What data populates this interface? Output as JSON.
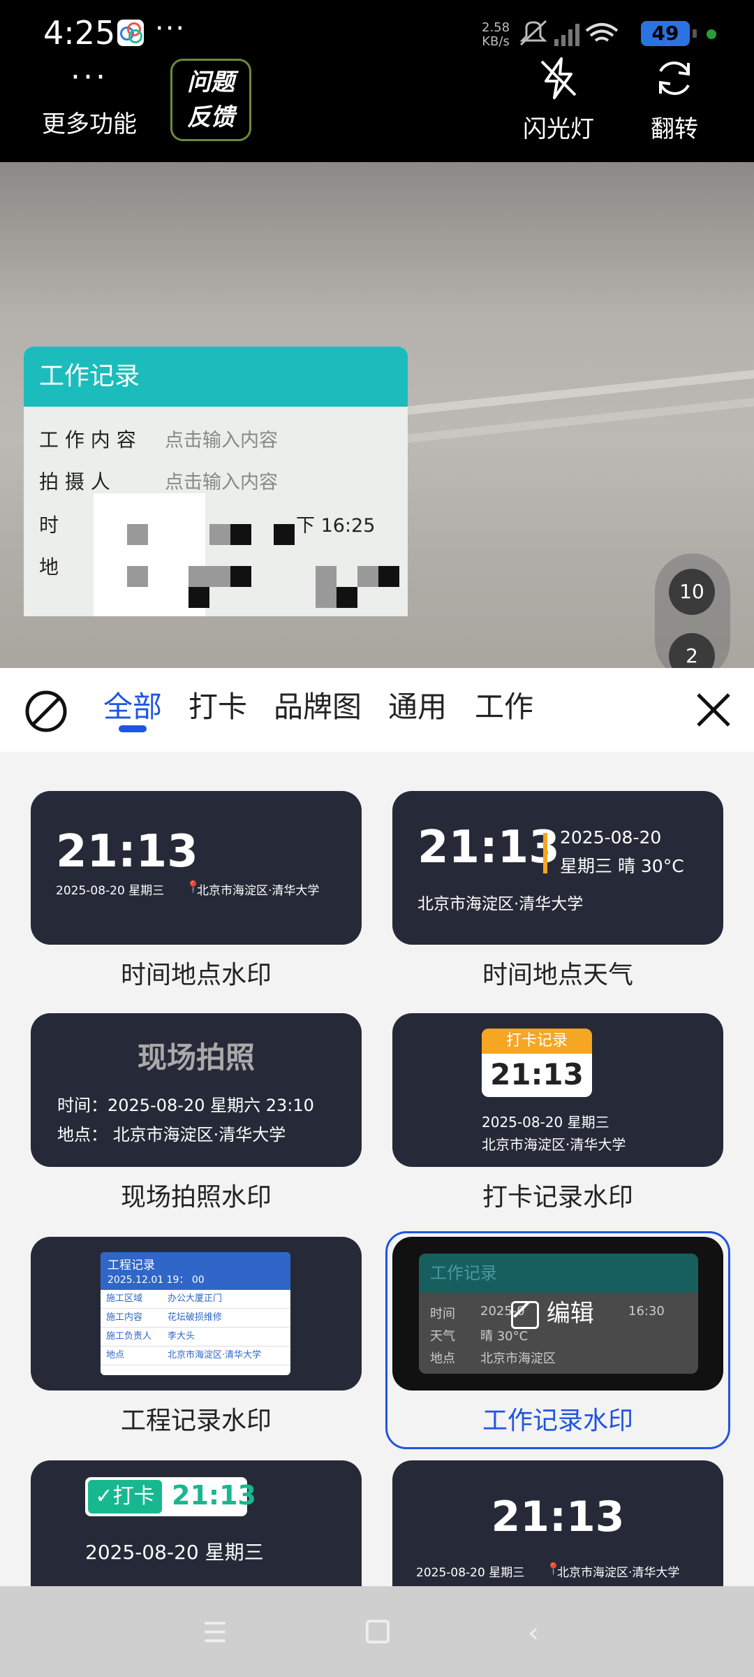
{
  "status": {
    "time": "4:25",
    "dots": "···",
    "speed_top": "2.58",
    "speed_bottom": "KB/s",
    "battery": "49"
  },
  "camera_bar": {
    "more_icon": "···",
    "more_label": "更多功能",
    "feedback_line1": "问题",
    "feedback_line2": "反馈",
    "flash_label": "闪光灯",
    "flip_label": "翻转"
  },
  "watermark": {
    "title": "工作记录",
    "rows": [
      {
        "label": "工 作 内 容",
        "value": "点击输入内容"
      },
      {
        "label": "拍   摄   人",
        "value": "点击输入内容"
      },
      {
        "label": "时",
        "value": "下 16:25"
      },
      {
        "label": "地",
        "value": ""
      }
    ]
  },
  "zoom": {
    "level1": "10",
    "level2": "2"
  },
  "tabs": [
    {
      "label": "全部",
      "active": true
    },
    {
      "label": "打卡"
    },
    {
      "label": "品牌图"
    },
    {
      "label": "通用"
    },
    {
      "label": "工作"
    }
  ],
  "templates": {
    "t1": {
      "time": "21:13",
      "line": "2025-08-20 星期三",
      "place": "北京市海淀区·清华大学",
      "caption": "时间地点水印"
    },
    "t2": {
      "time": "21:13",
      "date": "2025-08-20",
      "weather": "星期三 晴 30°C",
      "place": "北京市海淀区·清华大学",
      "caption": "时间地点天气"
    },
    "t3": {
      "title": "现场拍照",
      "time_line": "时间：2025-08-20  星期六 23:10",
      "place_line": "地点： 北京市海淀区·清华大学",
      "caption": "现场拍照水印"
    },
    "t4": {
      "badge": "打卡记录",
      "time": "21:13",
      "date": "2025-08-20 星期三",
      "place": "北京市海淀区·清华大学",
      "caption": "打卡记录水印"
    },
    "t5": {
      "title": "工程记录",
      "datetime": "2025.12.01 19： 00",
      "rows": [
        {
          "k": "施工区域",
          "v": "办公大厦正门"
        },
        {
          "k": "施工内容",
          "v": "花坛破损维修"
        },
        {
          "k": "施工负责人",
          "v": "李大头"
        },
        {
          "k": "地点",
          "v": "北京市海淀区·清华大学"
        }
      ],
      "caption": "工程记录水印"
    },
    "t6": {
      "title": "工作记录",
      "r1k": "时间",
      "r1v": "2025-0",
      "r1v2": "16:30",
      "r2k": "天气",
      "r2v": "晴 30°C",
      "r3k": "地点",
      "r3v": "北京市海淀区",
      "edit": "编辑",
      "caption": "工作记录水印"
    },
    "t7": {
      "badge": "打卡",
      "time": "21:13",
      "date": "2025-08-20 星期三"
    },
    "t8": {
      "time": "21:13",
      "line": "2025-08-20 星期三",
      "place": "北京市海淀区·清华大学"
    }
  },
  "colors": {
    "accent": "#1f55e0",
    "card_bg": "#262a38",
    "teal": "#1cbcbc",
    "orange": "#f5a623"
  }
}
